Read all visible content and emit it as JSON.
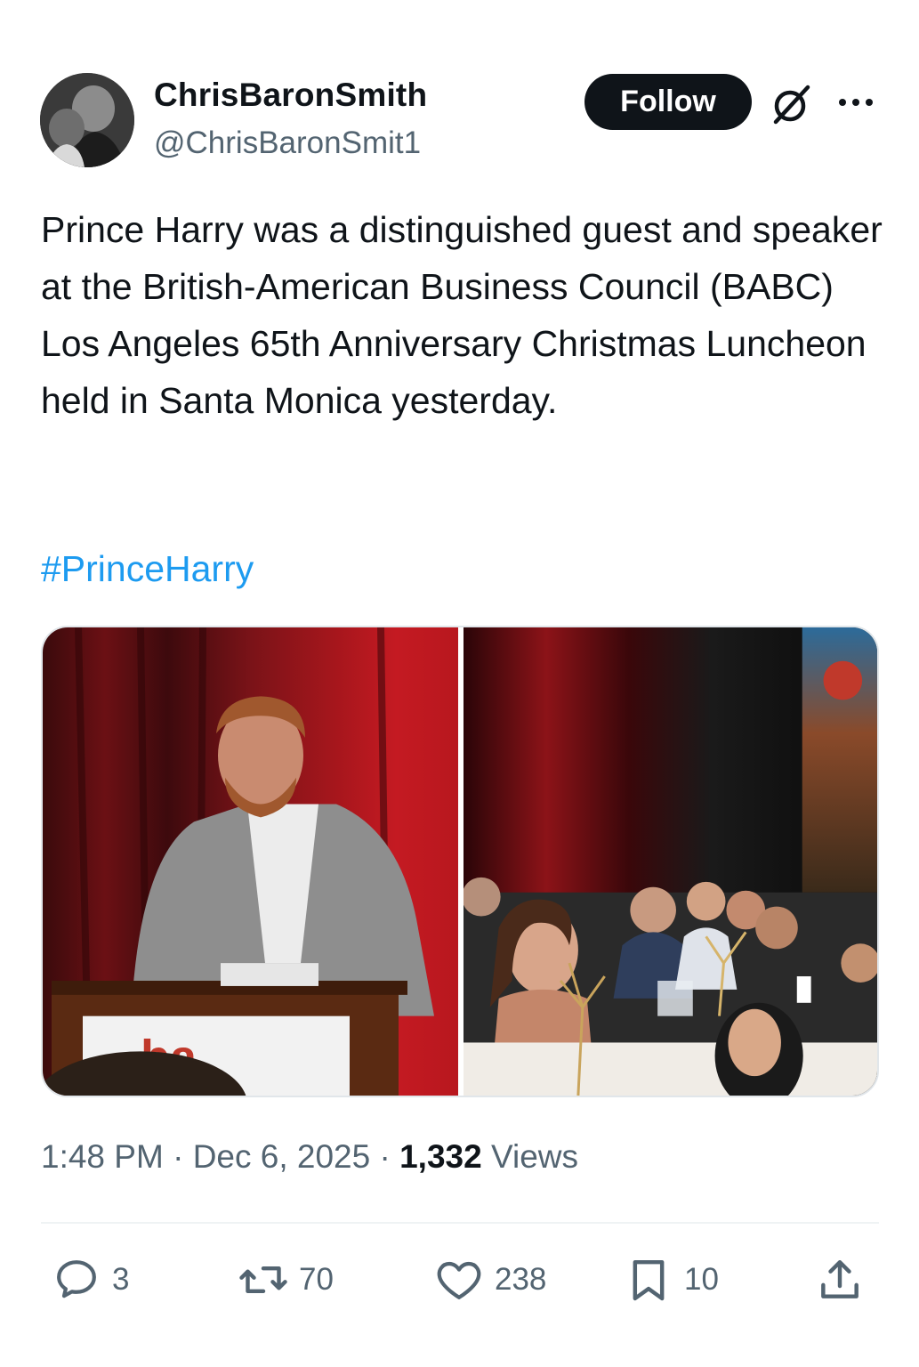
{
  "tweet": {
    "author": {
      "display_name": "ChrisBaronSmith",
      "handle": "@ChrisBaronSmit1"
    },
    "follow_label": "Follow",
    "text": "Prince Harry was a distinguished guest and speaker at the British-American Business Council (BABC) Los Angeles 65th Anniversary Christmas Luncheon held in Santa Monica yesterday.",
    "hashtag": "#PrinceHarry",
    "media": [
      {
        "icon": "photo-speaker-at-podium"
      },
      {
        "icon": "photo-luncheon-guests"
      }
    ],
    "meta": {
      "time": "1:48 PM",
      "separator": "·",
      "date": "Dec 6, 2025",
      "views_count": "1,332",
      "views_label": "Views"
    },
    "actions": {
      "replies": "3",
      "reposts": "70",
      "likes": "238",
      "bookmarks": "10"
    }
  },
  "colors": {
    "text": "#0f1419",
    "secondary": "#536471",
    "link": "#1d9bf0",
    "button_bg": "#0f1419",
    "button_text": "#ffffff"
  }
}
